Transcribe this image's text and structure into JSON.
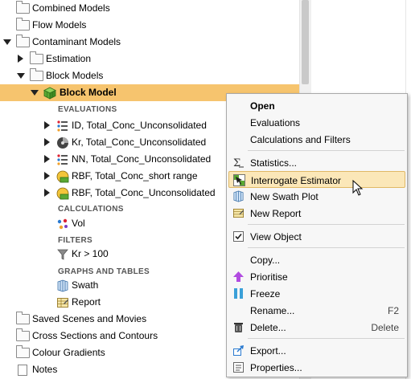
{
  "tree": {
    "combined_models": "Combined Models",
    "flow_models": "Flow Models",
    "contaminant_models": "Contaminant Models",
    "estimation": "Estimation",
    "block_models": "Block Models",
    "block_model": "Block Model",
    "evaluations_header": "EVALUATIONS",
    "eval1": "ID, Total_Conc_Unconsolidated",
    "eval2": "Kr, Total_Conc_Unconsolidated",
    "eval3": "NN, Total_Conc_Unconsolidated",
    "eval4": "RBF, Total_Conc_short range",
    "eval5": "RBF, Total_Conc_Unconsolidated",
    "calculations_header": "CALCULATIONS",
    "vol": "Vol",
    "filters_header": "FILTERS",
    "filter1": "Kr > 100",
    "graphs_header": "GRAPHS AND TABLES",
    "swath": "Swath",
    "report": "Report",
    "saved_scenes": "Saved Scenes and Movies",
    "cross_sections": "Cross Sections and Contours",
    "colour_gradients": "Colour Gradients",
    "notes": "Notes"
  },
  "menu": {
    "open": "Open",
    "evaluations": "Evaluations",
    "calc_filters": "Calculations and Filters",
    "statistics": "Statistics...",
    "interrogate": "Interrogate Estimator",
    "new_swath": "New Swath Plot",
    "new_report": "New Report",
    "view_object": "View Object",
    "copy": "Copy...",
    "prioritise": "Prioritise",
    "freeze": "Freeze",
    "rename": "Rename...",
    "rename_shortcut": "F2",
    "delete": "Delete...",
    "delete_shortcut": "Delete",
    "export": "Export...",
    "properties": "Properties..."
  },
  "colors": {
    "selected_row": "#f6c46e",
    "menu_highlight": "#fbe7b8",
    "accent_green": "#5aa832"
  }
}
